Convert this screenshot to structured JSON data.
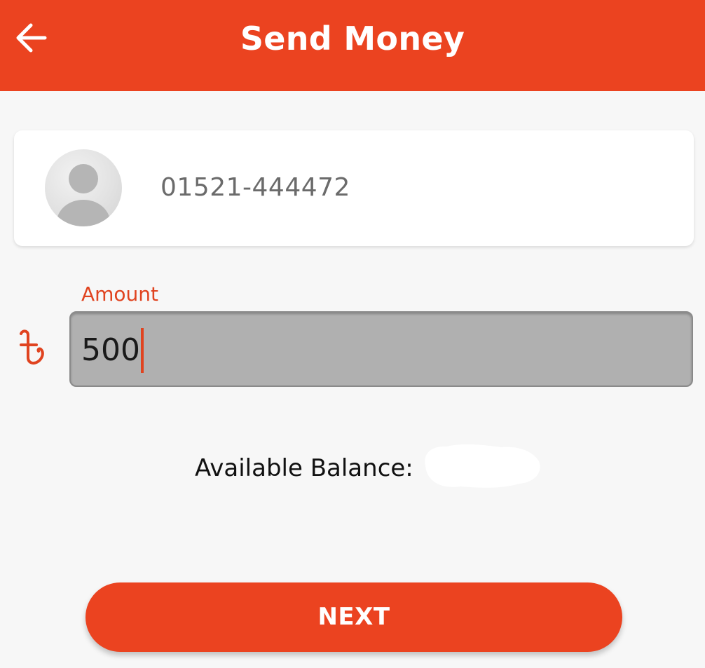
{
  "header": {
    "title": "Send Money",
    "back_icon": "arrow-left-icon"
  },
  "recipient": {
    "avatar_icon": "user-avatar-icon",
    "phone": "01521-444472"
  },
  "amount": {
    "label": "Amount",
    "currency_icon": "taka-icon",
    "value": "500"
  },
  "balance": {
    "label": "Available Balance:"
  },
  "actions": {
    "next_label": "NEXT"
  },
  "colors": {
    "accent": "#eb4320",
    "field_background": "#b0b0b0",
    "page_background": "#f7f7f7"
  }
}
